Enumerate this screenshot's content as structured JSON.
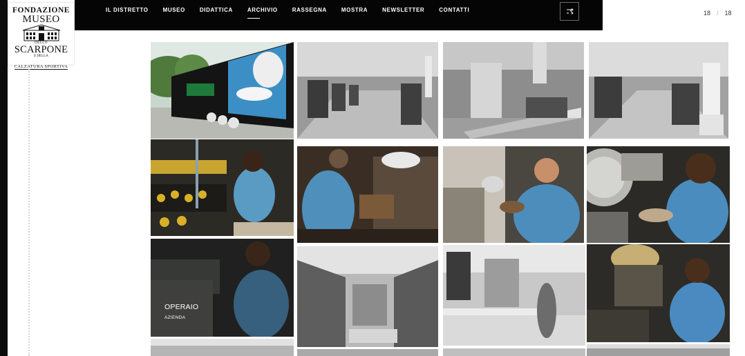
{
  "logo": {
    "line1": "FONDAZIONE",
    "line2": "MUSEO",
    "line3": "DELLO",
    "line4": "SCARPONE",
    "line5": "E DELLA",
    "line6": "CALZATURA SPORTIVA"
  },
  "nav": {
    "items": [
      {
        "label": "IL DISTRETTO"
      },
      {
        "label": "MUSEO"
      },
      {
        "label": "DIDATTICA"
      },
      {
        "label": "ARCHIVIO"
      },
      {
        "label": "RASSEGNA"
      },
      {
        "label": "MOSTRA"
      },
      {
        "label": "NEWSLETTER"
      },
      {
        "label": "CONTATTI"
      }
    ],
    "active": "ARCHIVIO",
    "shuffle_icon": "shuffle-icon"
  },
  "pager": {
    "current": "18",
    "total": "18",
    "separator": "/"
  },
  "hover_caption": {
    "title": "OPERAIO",
    "subtitle": "AZIENDA"
  },
  "photos": [
    {
      "subject": "truck-trailer-advertising",
      "tone": "color"
    },
    {
      "subject": "factory-hall-machines",
      "tone": "bw"
    },
    {
      "subject": "factory-conveyor",
      "tone": "bw"
    },
    {
      "subject": "factory-hall-machines",
      "tone": "bw"
    },
    {
      "subject": "worker-boots-rack",
      "tone": "color"
    },
    {
      "subject": "worker-machine",
      "tone": "color"
    },
    {
      "subject": "worker-glasses-lamp",
      "tone": "color"
    },
    {
      "subject": "worker-wheel-machine",
      "tone": "color"
    },
    {
      "subject": "worker-operaio",
      "tone": "color"
    },
    {
      "subject": "warehouse-shelves",
      "tone": "bw"
    },
    {
      "subject": "workshop-boxes",
      "tone": "bw"
    },
    {
      "subject": "worker-press-machine",
      "tone": "color"
    }
  ]
}
